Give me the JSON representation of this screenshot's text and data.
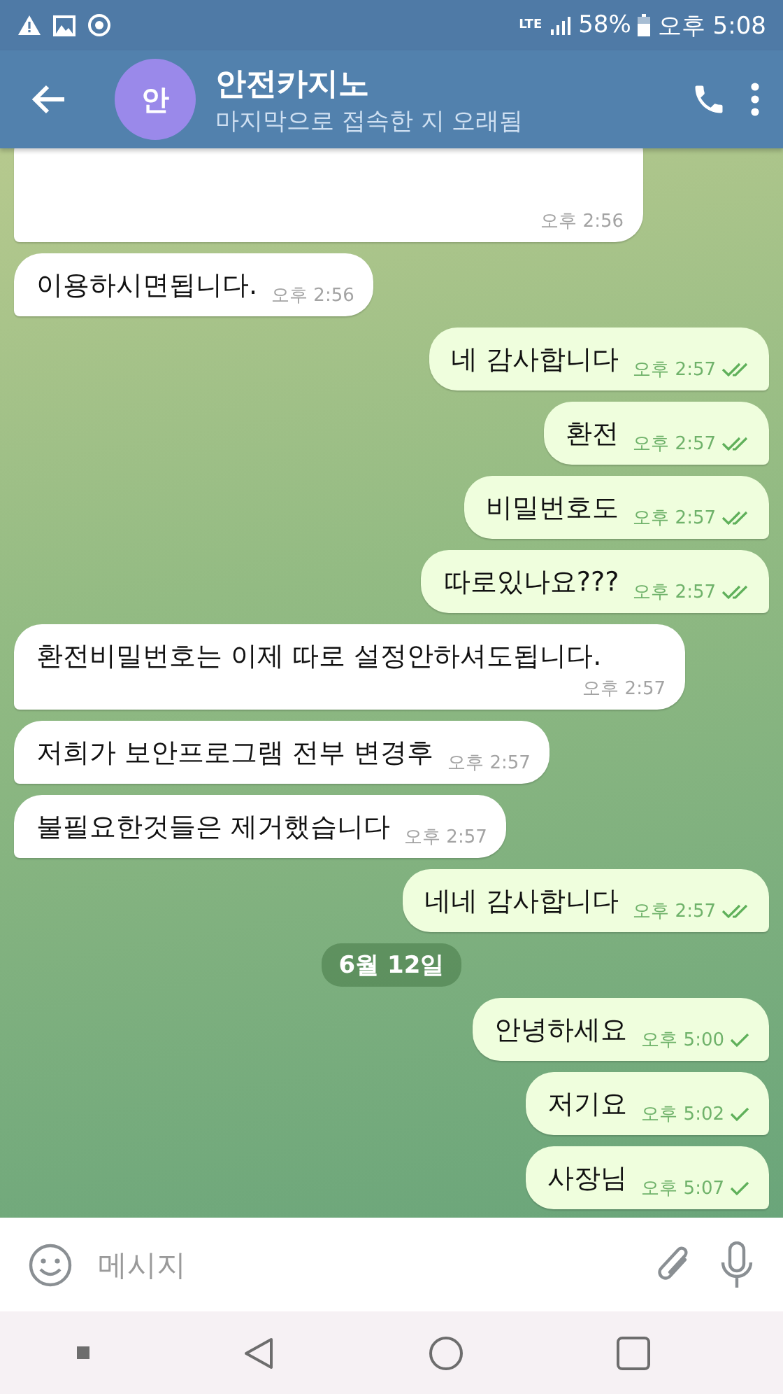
{
  "status_bar": {
    "battery": "58%",
    "time": "오후 5:08",
    "network": "LTE"
  },
  "header": {
    "avatar_letter": "안",
    "title": "안전카지노",
    "subtitle": "마지막으로 접속한 지 오래됨"
  },
  "messages": [
    {
      "kind": "received",
      "time": "오후 2:56"
    },
    {
      "kind": "received",
      "text": "이용하시면됩니다.",
      "time": "오후 2:56"
    },
    {
      "kind": "sent",
      "text": "네 감사합니다",
      "time": "오후 2:57",
      "read": true
    },
    {
      "kind": "sent",
      "text": "환전",
      "time": "오후 2:57",
      "read": true
    },
    {
      "kind": "sent",
      "text": "비밀번호도",
      "time": "오후 2:57",
      "read": true
    },
    {
      "kind": "sent",
      "text": "따로있나요???",
      "time": "오후 2:57",
      "read": true
    },
    {
      "kind": "received",
      "text": "환전비밀번호는 이제 따로 설정안하셔도됩니다.",
      "time": "오후 2:57"
    },
    {
      "kind": "received",
      "text": "저희가 보안프로그램 전부 변경후",
      "time": "오후 2:57"
    },
    {
      "kind": "received",
      "text": "불필요한것들은 제거했습니다",
      "time": "오후 2:57"
    },
    {
      "kind": "sent",
      "text": "네네 감사합니다",
      "time": "오후 2:57",
      "read": true
    },
    {
      "kind": "date",
      "text": "6월 12일"
    },
    {
      "kind": "sent",
      "text": "안녕하세요",
      "time": "오후 5:00",
      "read": false
    },
    {
      "kind": "sent",
      "text": "저기요",
      "time": "오후 5:02",
      "read": false
    },
    {
      "kind": "sent",
      "text": "사장님",
      "time": "오후 5:07",
      "read": false
    }
  ],
  "composer": {
    "placeholder": "메시지"
  }
}
